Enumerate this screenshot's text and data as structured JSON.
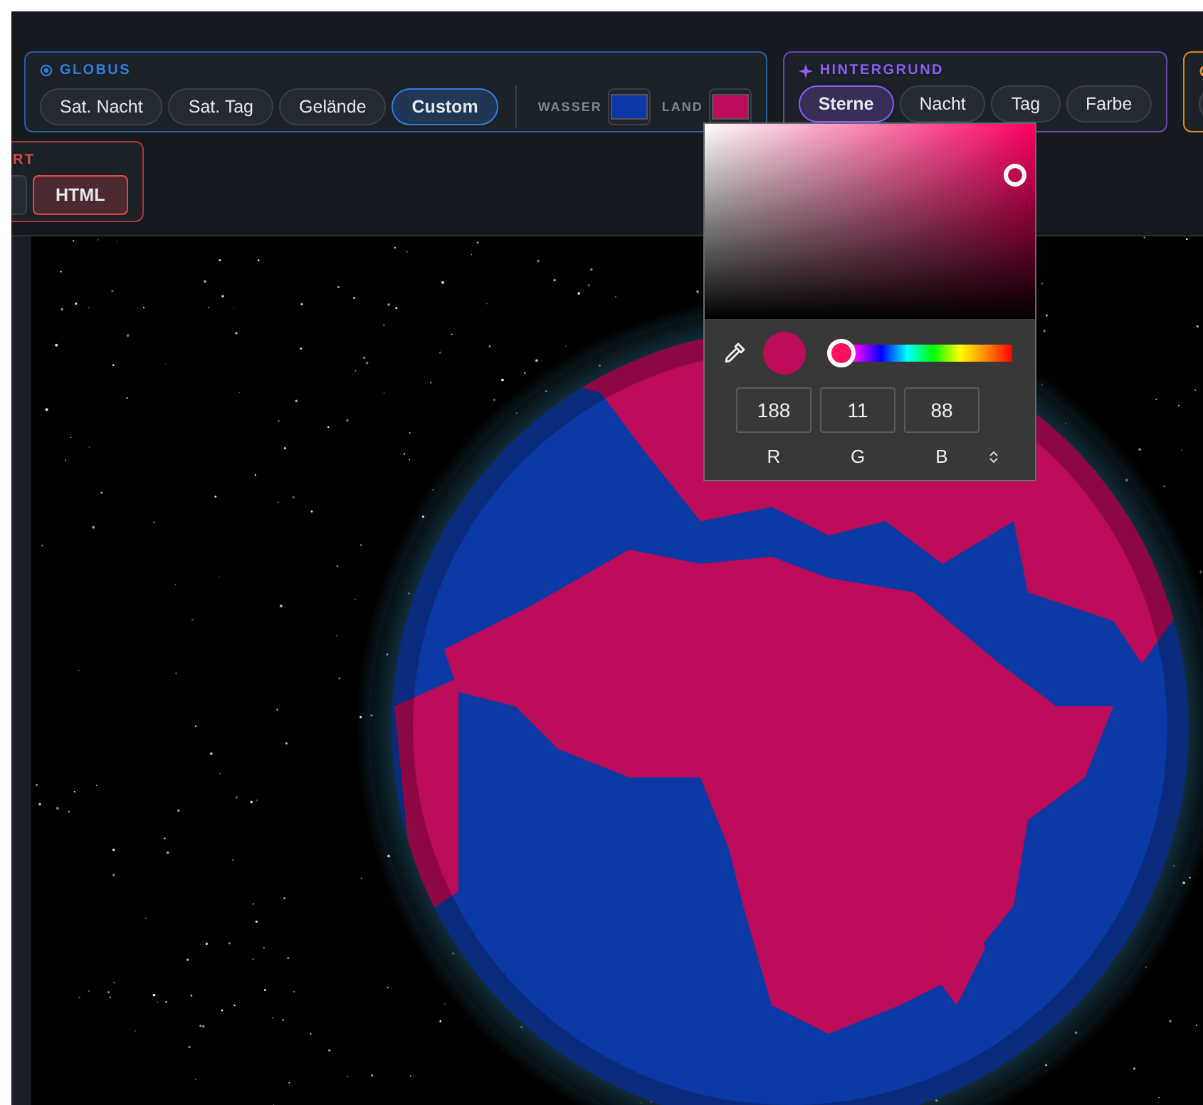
{
  "groups": [
    {
      "label": "GLOBUS",
      "color": "#2f7de0",
      "buttons": [
        {
          "label": "Sat. Nacht",
          "selected": false
        },
        {
          "label": "Sat. Tag",
          "selected": false
        },
        {
          "label": "Gelände",
          "selected": false
        },
        {
          "label": "Custom",
          "selected": true
        }
      ],
      "swatches": [
        {
          "label": "WASSER",
          "color": "#0b3aa6"
        },
        {
          "label": "LAND",
          "color": "#bc0b58"
        }
      ]
    },
    {
      "label": "HINTERGRUND",
      "color": "#8a5cf0",
      "buttons": [
        {
          "label": "Sterne",
          "selected": true
        },
        {
          "label": "Nacht",
          "selected": false
        },
        {
          "label": "Tag",
          "selected": false
        },
        {
          "label": "Farbe",
          "selected": false
        }
      ]
    }
  ],
  "export_group": {
    "label": "RT",
    "color": "#e04848",
    "buttons": [
      {
        "label": "HTML",
        "selected": true
      }
    ]
  },
  "color_picker": {
    "color": "#bc0b58",
    "hue_slider": {
      "level": 0.07
    },
    "channels": [
      {
        "value": "188",
        "label": "R"
      },
      {
        "value": "11",
        "label": "G"
      },
      {
        "value": "88",
        "label": "B"
      }
    ]
  }
}
